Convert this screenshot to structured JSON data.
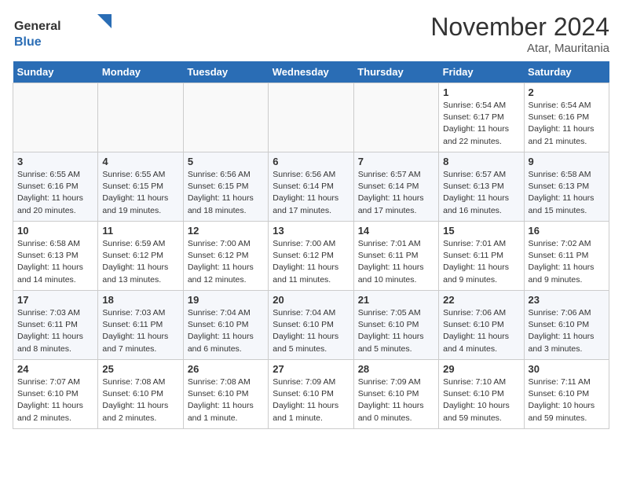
{
  "logo": {
    "general": "General",
    "blue": "Blue"
  },
  "title": "November 2024",
  "subtitle": "Atar, Mauritania",
  "days_header": [
    "Sunday",
    "Monday",
    "Tuesday",
    "Wednesday",
    "Thursday",
    "Friday",
    "Saturday"
  ],
  "weeks": [
    [
      {
        "day": "",
        "info": ""
      },
      {
        "day": "",
        "info": ""
      },
      {
        "day": "",
        "info": ""
      },
      {
        "day": "",
        "info": ""
      },
      {
        "day": "",
        "info": ""
      },
      {
        "day": "1",
        "info": "Sunrise: 6:54 AM\nSunset: 6:17 PM\nDaylight: 11 hours and 22 minutes."
      },
      {
        "day": "2",
        "info": "Sunrise: 6:54 AM\nSunset: 6:16 PM\nDaylight: 11 hours and 21 minutes."
      }
    ],
    [
      {
        "day": "3",
        "info": "Sunrise: 6:55 AM\nSunset: 6:16 PM\nDaylight: 11 hours and 20 minutes."
      },
      {
        "day": "4",
        "info": "Sunrise: 6:55 AM\nSunset: 6:15 PM\nDaylight: 11 hours and 19 minutes."
      },
      {
        "day": "5",
        "info": "Sunrise: 6:56 AM\nSunset: 6:15 PM\nDaylight: 11 hours and 18 minutes."
      },
      {
        "day": "6",
        "info": "Sunrise: 6:56 AM\nSunset: 6:14 PM\nDaylight: 11 hours and 17 minutes."
      },
      {
        "day": "7",
        "info": "Sunrise: 6:57 AM\nSunset: 6:14 PM\nDaylight: 11 hours and 17 minutes."
      },
      {
        "day": "8",
        "info": "Sunrise: 6:57 AM\nSunset: 6:13 PM\nDaylight: 11 hours and 16 minutes."
      },
      {
        "day": "9",
        "info": "Sunrise: 6:58 AM\nSunset: 6:13 PM\nDaylight: 11 hours and 15 minutes."
      }
    ],
    [
      {
        "day": "10",
        "info": "Sunrise: 6:58 AM\nSunset: 6:13 PM\nDaylight: 11 hours and 14 minutes."
      },
      {
        "day": "11",
        "info": "Sunrise: 6:59 AM\nSunset: 6:12 PM\nDaylight: 11 hours and 13 minutes."
      },
      {
        "day": "12",
        "info": "Sunrise: 7:00 AM\nSunset: 6:12 PM\nDaylight: 11 hours and 12 minutes."
      },
      {
        "day": "13",
        "info": "Sunrise: 7:00 AM\nSunset: 6:12 PM\nDaylight: 11 hours and 11 minutes."
      },
      {
        "day": "14",
        "info": "Sunrise: 7:01 AM\nSunset: 6:11 PM\nDaylight: 11 hours and 10 minutes."
      },
      {
        "day": "15",
        "info": "Sunrise: 7:01 AM\nSunset: 6:11 PM\nDaylight: 11 hours and 9 minutes."
      },
      {
        "day": "16",
        "info": "Sunrise: 7:02 AM\nSunset: 6:11 PM\nDaylight: 11 hours and 9 minutes."
      }
    ],
    [
      {
        "day": "17",
        "info": "Sunrise: 7:03 AM\nSunset: 6:11 PM\nDaylight: 11 hours and 8 minutes."
      },
      {
        "day": "18",
        "info": "Sunrise: 7:03 AM\nSunset: 6:11 PM\nDaylight: 11 hours and 7 minutes."
      },
      {
        "day": "19",
        "info": "Sunrise: 7:04 AM\nSunset: 6:10 PM\nDaylight: 11 hours and 6 minutes."
      },
      {
        "day": "20",
        "info": "Sunrise: 7:04 AM\nSunset: 6:10 PM\nDaylight: 11 hours and 5 minutes."
      },
      {
        "day": "21",
        "info": "Sunrise: 7:05 AM\nSunset: 6:10 PM\nDaylight: 11 hours and 5 minutes."
      },
      {
        "day": "22",
        "info": "Sunrise: 7:06 AM\nSunset: 6:10 PM\nDaylight: 11 hours and 4 minutes."
      },
      {
        "day": "23",
        "info": "Sunrise: 7:06 AM\nSunset: 6:10 PM\nDaylight: 11 hours and 3 minutes."
      }
    ],
    [
      {
        "day": "24",
        "info": "Sunrise: 7:07 AM\nSunset: 6:10 PM\nDaylight: 11 hours and 2 minutes."
      },
      {
        "day": "25",
        "info": "Sunrise: 7:08 AM\nSunset: 6:10 PM\nDaylight: 11 hours and 2 minutes."
      },
      {
        "day": "26",
        "info": "Sunrise: 7:08 AM\nSunset: 6:10 PM\nDaylight: 11 hours and 1 minute."
      },
      {
        "day": "27",
        "info": "Sunrise: 7:09 AM\nSunset: 6:10 PM\nDaylight: 11 hours and 1 minute."
      },
      {
        "day": "28",
        "info": "Sunrise: 7:09 AM\nSunset: 6:10 PM\nDaylight: 11 hours and 0 minutes."
      },
      {
        "day": "29",
        "info": "Sunrise: 7:10 AM\nSunset: 6:10 PM\nDaylight: 10 hours and 59 minutes."
      },
      {
        "day": "30",
        "info": "Sunrise: 7:11 AM\nSunset: 6:10 PM\nDaylight: 10 hours and 59 minutes."
      }
    ]
  ]
}
